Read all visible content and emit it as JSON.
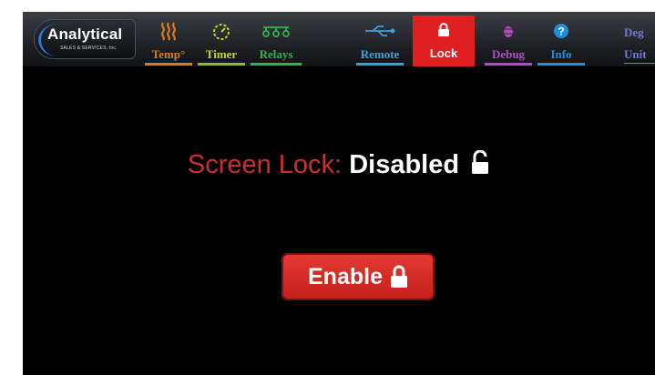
{
  "brand": {
    "name": "Analytical",
    "sub": "SALES & SERVICES, Inc."
  },
  "tabs": [
    {
      "label": "Temp°",
      "icon": "heat-coil-icon",
      "color": "#e0791a",
      "active": false
    },
    {
      "label": "Timer",
      "icon": "timer-icon",
      "color": "#c8d12a",
      "active": false
    },
    {
      "label": "Relays",
      "icon": "relays-icon",
      "color": "#2fb24a",
      "active": false
    },
    {
      "label": "Remote",
      "icon": "usb-icon",
      "color": "#3aa0d8",
      "active": false
    },
    {
      "label": "Lock",
      "icon": "lock-icon",
      "color": "#ffffff",
      "active": true
    },
    {
      "label": "Debug",
      "icon": "bug-icon",
      "color": "#b04cc7",
      "active": false
    },
    {
      "label": "Info",
      "icon": "info-icon",
      "color": "#1c8fe0",
      "active": false
    },
    {
      "label": "Unit",
      "icon": "degree-icon",
      "color": "#6d7ad6",
      "active": false,
      "top_text": "Deg"
    }
  ],
  "status": {
    "label": "Screen Lock:",
    "value": "Disabled"
  },
  "action": {
    "label": "Enable"
  },
  "colors": {
    "accent": "#e02020",
    "label_red": "#c7302c",
    "background": "#000000"
  }
}
